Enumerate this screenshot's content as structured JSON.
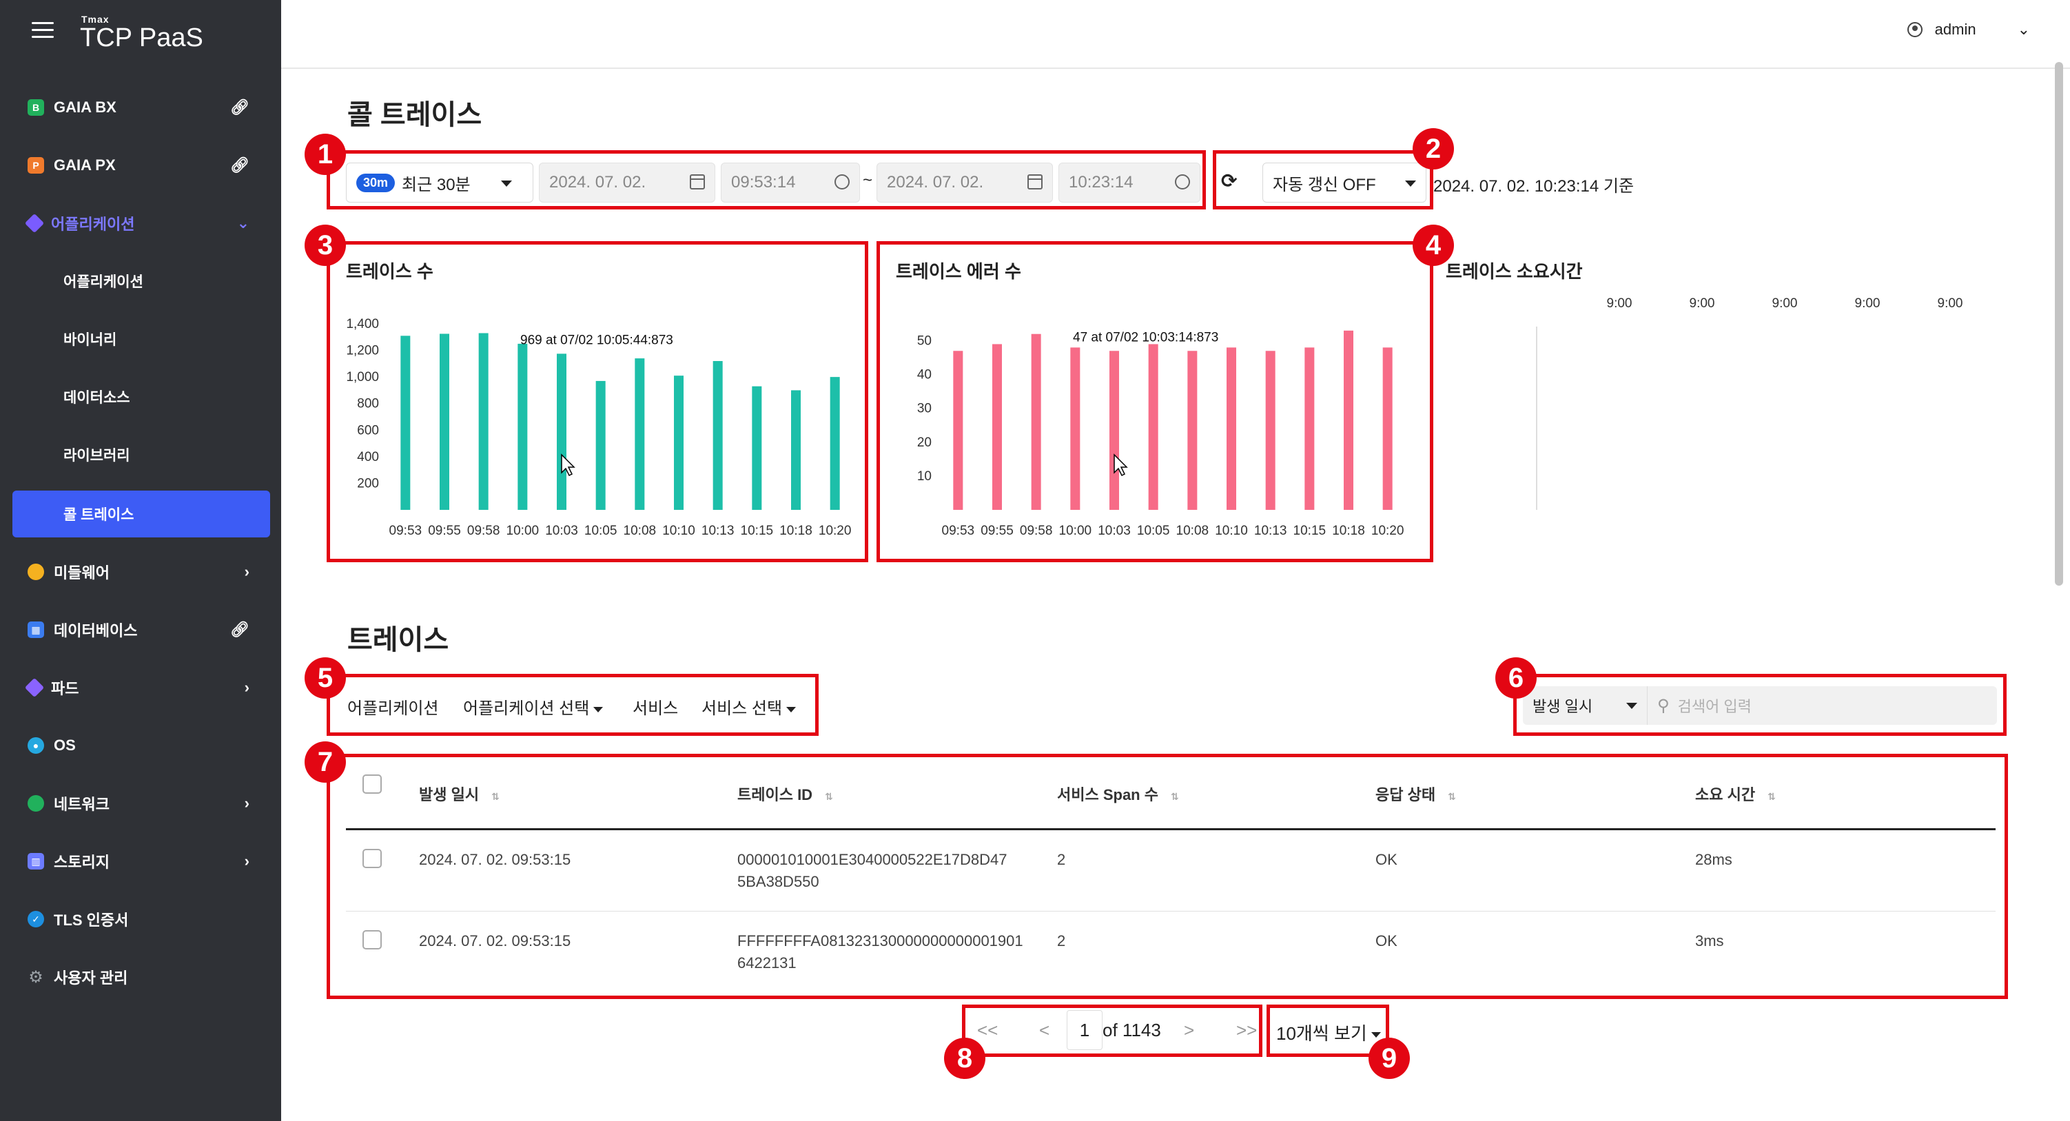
{
  "brand": {
    "small": "Tmax",
    "main": "TCP PaaS"
  },
  "sidebar": {
    "items": [
      {
        "label": "GAIA BX",
        "icon": "gaia-bx-icon",
        "trail": "link-icon",
        "color": "#21b15c"
      },
      {
        "label": "GAIA PX",
        "icon": "gaia-px-icon",
        "trail": "link-icon",
        "color": "#f07a2c"
      },
      {
        "label": "어플리케이션",
        "icon": "cube-icon",
        "trail": "chevron-down-icon",
        "color": "#7a5cff"
      },
      {
        "label": "어플리케이션"
      },
      {
        "label": "바이너리"
      },
      {
        "label": "데이터소스"
      },
      {
        "label": "라이브러리"
      },
      {
        "label": "콜 트레이스"
      },
      {
        "label": "미들웨어",
        "icon": "middleware-icon",
        "trail": "chevron-right-icon",
        "color": "#f5b120"
      },
      {
        "label": "데이터베이스",
        "icon": "grid-icon",
        "trail": "link-icon",
        "color": "#3b7cf0"
      },
      {
        "label": "파드",
        "icon": "pod-icon",
        "trail": "chevron-right-icon",
        "color": "#8a63ff"
      },
      {
        "label": "OS",
        "icon": "os-icon",
        "color": "#25a8e0"
      },
      {
        "label": "네트워크",
        "icon": "globe-icon",
        "trail": "chevron-right-icon",
        "color": "#21b15c"
      },
      {
        "label": "스토리지",
        "icon": "storage-icon",
        "trail": "chevron-right-icon",
        "color": "#6c7bff"
      },
      {
        "label": "TLS 인증서",
        "icon": "shield-icon",
        "color": "#1d8fe0"
      },
      {
        "label": "사용자 관리",
        "icon": "gear-icon",
        "color": "#9aa0a6"
      }
    ]
  },
  "topbar": {
    "user": "admin"
  },
  "page": {
    "title": "콜 트레이스"
  },
  "time_filter": {
    "range_chip": "30m",
    "range_label": "최근 30분",
    "start_date": "2024. 07. 02.",
    "start_time": "09:53:14",
    "separator": "~",
    "end_date": "2024. 07. 02.",
    "end_time": "10:23:14",
    "auto_refresh": "자동 갱신 OFF",
    "as_of": "2024. 07. 02. 10:23:14 기준"
  },
  "badges": [
    "1",
    "2",
    "3",
    "4",
    "5",
    "6",
    "7",
    "8",
    "9"
  ],
  "chart_data": [
    {
      "type": "bar",
      "title": "트레이스 수",
      "categories": [
        "09:53",
        "09:55",
        "09:58",
        "10:00",
        "10:03",
        "10:05",
        "10:08",
        "10:10",
        "10:13",
        "10:15",
        "10:18",
        "10:20"
      ],
      "values": [
        1310,
        1325,
        1330,
        1250,
        1175,
        970,
        1140,
        1010,
        1120,
        930,
        900,
        1000
      ],
      "yticks": [
        "200",
        "400",
        "600",
        "800",
        "1,000",
        "1,200",
        "1,400"
      ],
      "ylim": [
        0,
        1400
      ],
      "annotation": "969 at 07/02 10:05:44:873",
      "color": "#1dbfa9"
    },
    {
      "type": "bar",
      "title": "트레이스 에러 수",
      "categories": [
        "09:53",
        "09:55",
        "09:58",
        "10:00",
        "10:03",
        "10:05",
        "10:08",
        "10:10",
        "10:13",
        "10:15",
        "10:18",
        "10:20"
      ],
      "values": [
        47,
        49,
        52,
        48,
        47,
        49,
        47,
        48,
        47,
        48,
        53,
        48
      ],
      "yticks": [
        "10",
        "20",
        "30",
        "40",
        "50"
      ],
      "ylim": [
        0,
        55
      ],
      "annotation": "47 at 07/02 10:03:14:873",
      "color": "#f76b87"
    },
    {
      "type": "scatter",
      "title": "트레이스 소요시간",
      "xticks": [
        "9:00",
        "9:00",
        "9:00",
        "9:00",
        "9:00"
      ],
      "values": []
    }
  ],
  "trace": {
    "title": "트레이스",
    "filters": {
      "app_label": "어플리케이션",
      "app_select": "어플리케이션 선택",
      "service_label": "서비스",
      "service_select": "서비스 선택"
    },
    "search": {
      "field": "발생 일시",
      "placeholder": "검색어 입력"
    },
    "columns": [
      "발생 일시",
      "트레이스 ID",
      "서비스 Span 수",
      "응답 상태",
      "소요 시간"
    ],
    "rows": [
      {
        "time": "2024. 07. 02. 09:53:15",
        "id1": "000001010001E3040000522E17D8D47",
        "id2": "5BA38D550",
        "spans": "2",
        "status": "OK",
        "duration": "28ms"
      },
      {
        "time": "2024. 07. 02. 09:53:15",
        "id1": "FFFFFFFFA081323130000000000001901",
        "id2": "6422131",
        "spans": "2",
        "status": "OK",
        "duration": "3ms"
      }
    ]
  },
  "pagination": {
    "first": "<<",
    "prev": "<",
    "page": "1",
    "of": "of 1143",
    "next": ">",
    "last": ">>",
    "page_size": "10개씩 보기"
  }
}
